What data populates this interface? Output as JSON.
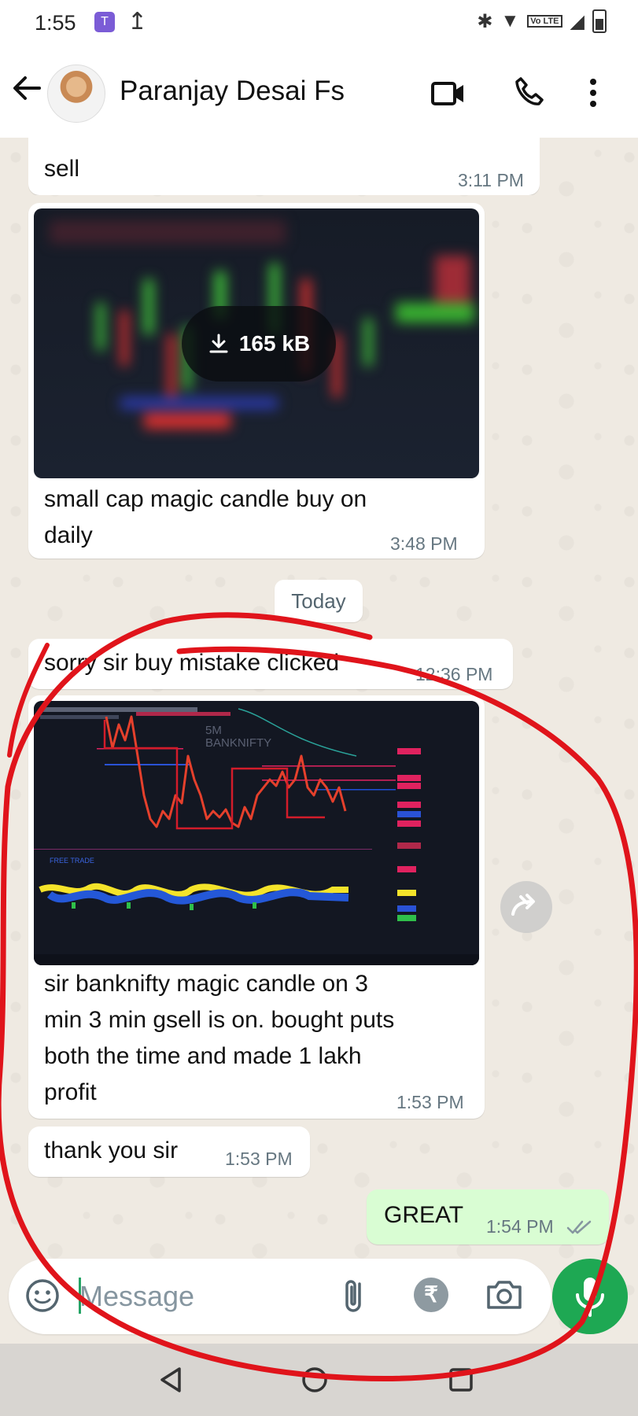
{
  "status_bar": {
    "time": "1:55",
    "app_icon": "T",
    "lte_label": "Vo LTE"
  },
  "header": {
    "contact_name": "Paranjay Desai Fs"
  },
  "messages": [
    {
      "text": "sell",
      "time": "3:11 PM"
    },
    {
      "type": "image",
      "download_size": "165 kB",
      "text": "small cap magic candle buy on\ndaily",
      "time": "3:48 PM"
    },
    {
      "text": "sorry sir buy mistake clicked",
      "time": "12:36 PM"
    },
    {
      "type": "image",
      "chart_title": "BANKNIFTY",
      "text": "sir banknifty magic candle on 3\nmin  3 min gsell is on. bought puts\nboth the time and made 1 lakh\nprofit",
      "time": "1:53 PM"
    },
    {
      "text": "thank you sir",
      "time": "1:53 PM"
    },
    {
      "text": "GREAT",
      "time": "1:54 PM",
      "outgoing": true,
      "status": "read"
    }
  ],
  "day_separator": "Today",
  "input": {
    "placeholder": "Message"
  },
  "colors": {
    "accent_green": "#1ea853",
    "outgoing_bubble": "#d9fdd3",
    "annotation_red": "#e0141b"
  }
}
